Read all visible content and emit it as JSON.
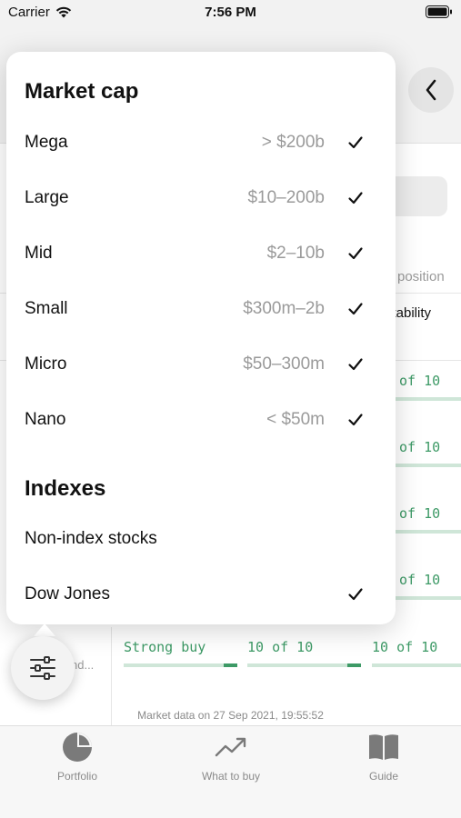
{
  "status_bar": {
    "carrier": "Carrier",
    "time": "7:56 PM"
  },
  "background": {
    "column_heads": [
      "position",
      "fitability"
    ],
    "ratings": [
      "of 10",
      "of 10",
      "of 10",
      "of 10"
    ],
    "last_row": {
      "label": "nd...",
      "rating_text": "Strong buy",
      "score_1": "10 of 10",
      "score_2": "10 of 10"
    }
  },
  "popup": {
    "market_cap": {
      "title": "Market cap",
      "options": [
        {
          "label": "Mega",
          "range": "> $200b",
          "checked": true
        },
        {
          "label": "Large",
          "range": "$10–200b",
          "checked": true
        },
        {
          "label": "Mid",
          "range": "$2–10b",
          "checked": true
        },
        {
          "label": "Small",
          "range": "$300m–2b",
          "checked": true
        },
        {
          "label": "Micro",
          "range": "$50–300m",
          "checked": true
        },
        {
          "label": "Nano",
          "range": "< $50m",
          "checked": true
        }
      ]
    },
    "indexes": {
      "title": "Indexes",
      "options": [
        {
          "label": "Non-index stocks",
          "checked": false
        },
        {
          "label": "Dow Jones",
          "checked": true
        }
      ]
    }
  },
  "footer": {
    "market_data": "Market data on 27 Sep 2021, 19:55:52"
  },
  "tabs": [
    {
      "label": "Portfolio",
      "icon": "pie-chart-icon"
    },
    {
      "label": "What to buy",
      "icon": "trend-up-icon"
    },
    {
      "label": "Guide",
      "icon": "book-icon"
    }
  ],
  "colors": {
    "accent_green": "#3d9a66",
    "muted_text": "#9a9a9a"
  }
}
